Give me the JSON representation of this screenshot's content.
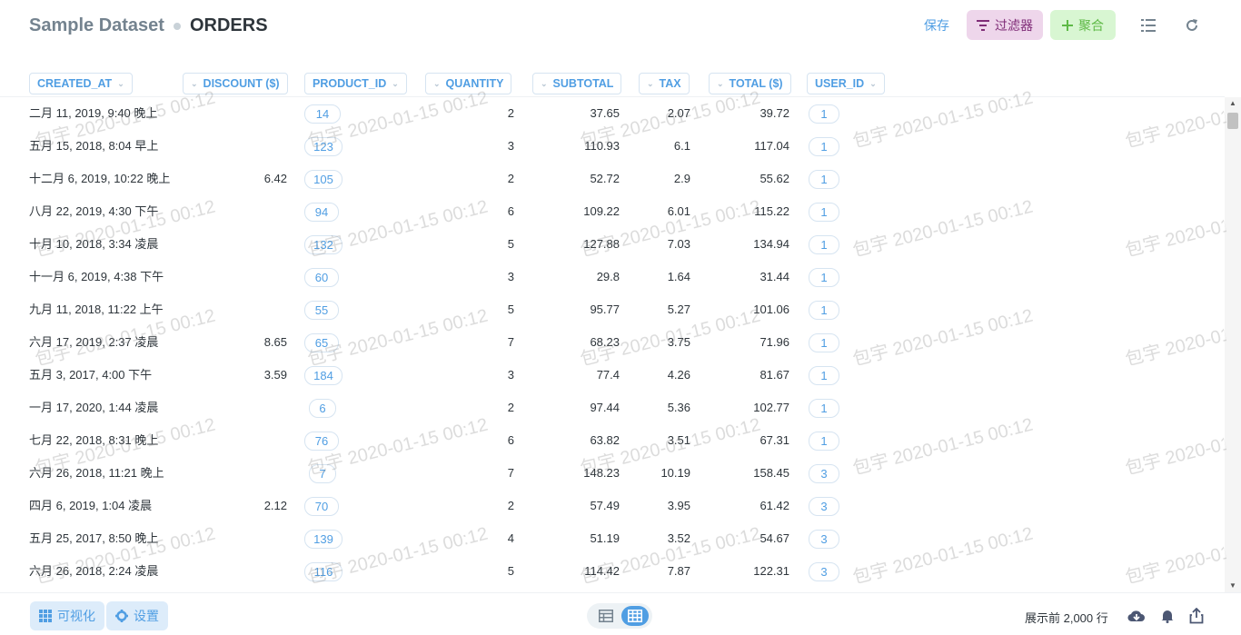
{
  "header": {
    "database": "Sample Dataset",
    "table": "ORDERS",
    "save_label": "保存",
    "filter_label": "过滤器",
    "summarize_label": "聚合"
  },
  "columns": [
    "CREATED_AT",
    "DISCOUNT ($)",
    "PRODUCT_ID",
    "QUANTITY",
    "SUBTOTAL",
    "TAX",
    "TOTAL ($)",
    "USER_ID"
  ],
  "rows": [
    [
      "二月 11, 2019, 9:40 晚上",
      "",
      "14",
      "2",
      "37.65",
      "2.07",
      "39.72",
      "1"
    ],
    [
      "五月 15, 2018, 8:04 早上",
      "",
      "123",
      "3",
      "110.93",
      "6.1",
      "117.04",
      "1"
    ],
    [
      "十二月 6, 2019, 10:22 晚上",
      "6.42",
      "105",
      "2",
      "52.72",
      "2.9",
      "55.62",
      "1"
    ],
    [
      "八月 22, 2019, 4:30 下午",
      "",
      "94",
      "6",
      "109.22",
      "6.01",
      "115.22",
      "1"
    ],
    [
      "十月 10, 2018, 3:34 凌晨",
      "",
      "132",
      "5",
      "127.88",
      "7.03",
      "134.94",
      "1"
    ],
    [
      "十一月 6, 2019, 4:38 下午",
      "",
      "60",
      "3",
      "29.8",
      "1.64",
      "31.44",
      "1"
    ],
    [
      "九月 11, 2018, 11:22 上午",
      "",
      "55",
      "5",
      "95.77",
      "5.27",
      "101.06",
      "1"
    ],
    [
      "六月 17, 2019, 2:37 凌晨",
      "8.65",
      "65",
      "7",
      "68.23",
      "3.75",
      "71.96",
      "1"
    ],
    [
      "五月 3, 2017, 4:00 下午",
      "3.59",
      "184",
      "3",
      "77.4",
      "4.26",
      "81.67",
      "1"
    ],
    [
      "一月 17, 2020, 1:44 凌晨",
      "",
      "6",
      "2",
      "97.44",
      "5.36",
      "102.77",
      "1"
    ],
    [
      "七月 22, 2018, 8:31 晚上",
      "",
      "76",
      "6",
      "63.82",
      "3.51",
      "67.31",
      "1"
    ],
    [
      "六月 26, 2018, 11:21 晚上",
      "",
      "7",
      "7",
      "148.23",
      "10.19",
      "158.45",
      "3"
    ],
    [
      "四月 6, 2019, 1:04 凌晨",
      "2.12",
      "70",
      "2",
      "57.49",
      "3.95",
      "61.42",
      "3"
    ],
    [
      "五月 25, 2017, 8:50 晚上",
      "",
      "139",
      "4",
      "51.19",
      "3.52",
      "54.67",
      "3"
    ],
    [
      "六月 26, 2018, 2:24 凌晨",
      "",
      "116",
      "5",
      "114.42",
      "7.87",
      "122.31",
      "3"
    ]
  ],
  "watermark": "包宇 2020-01-15 00:12",
  "footer": {
    "visualize_label": "可视化",
    "settings_label": "设置",
    "row_count": "展示前 2,000 行"
  },
  "icons": [
    "filter-icon",
    "plus-icon",
    "list-icon",
    "refresh-icon",
    "grid-icon",
    "gear-icon",
    "table-icon",
    "download-icon",
    "bell-icon",
    "share-icon"
  ],
  "colors": {
    "brand": "#509ee3",
    "filter_bg": "#eed6eb",
    "filter_fg": "#7f2c77",
    "summarize_bg": "#d8f6d2",
    "summarize_fg": "#5eb946"
  }
}
